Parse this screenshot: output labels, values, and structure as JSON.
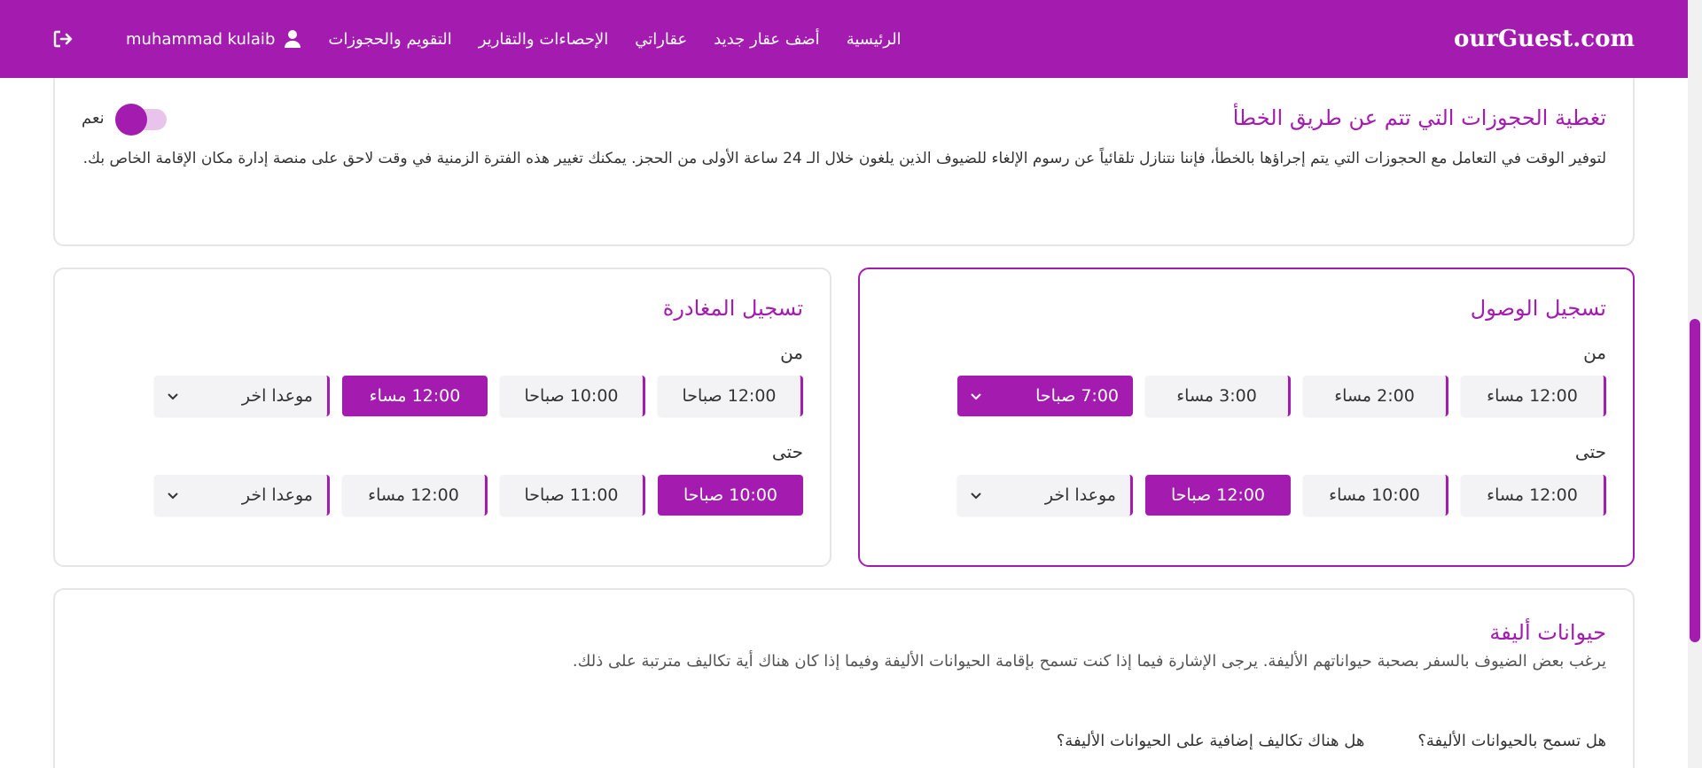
{
  "header": {
    "brand": "ourGuest.com",
    "nav": [
      "الرئيسية",
      "أضف عقار جديد",
      "عقاراتي",
      "الإحصاءات والتقارير",
      "التقويم والحجوزات"
    ],
    "user_name": "muhammad kulaib",
    "icons": {
      "user": "user-icon",
      "logout": "logout-icon"
    }
  },
  "mistaken_bookings": {
    "title": "تغطية الحجوزات التي تتم عن طريق الخطأ",
    "toggle_label": "نعم",
    "toggle_on": true,
    "description": "لتوفير الوقت في التعامل مع الحجوزات التي يتم إجراؤها بالخطأ، فإننا نتنازل تلقائياً عن رسوم الإلغاء للضيوف الذين يلغون خلال الـ 24 ساعة الأولى من الحجز. يمكنك تغيير هذه الفترة الزمنية في وقت لاحق على منصة إدارة مكان الإقامة الخاص بك."
  },
  "checkin": {
    "title": "تسجيل الوصول",
    "from_label": "من",
    "from_options": [
      "12:00 مساء",
      "2:00 مساء",
      "3:00 مساء"
    ],
    "from_selected": "7:00 صباحا",
    "to_label": "حتى",
    "to_options": [
      "12:00 مساء",
      "10:00 مساء"
    ],
    "to_selected": "12:00 صباحا",
    "to_other": "موعدا اخر"
  },
  "checkout": {
    "title": "تسجيل المغادرة",
    "from_label": "من",
    "from_options": [
      "12:00 صباحا",
      "10:00 صباحا"
    ],
    "from_selected": "12:00 مساء",
    "from_other": "موعدا اخر",
    "to_label": "حتى",
    "to_selected": "10:00 صباحا",
    "to_options": [
      "11:00 صباحا",
      "12:00 مساء"
    ],
    "to_other": "موعدا اخر"
  },
  "pets": {
    "title": "حيوانات أليفة",
    "description": "يرغب بعض الضيوف بالسفر بصحبة حيواناتهم الأليفة. يرجى الإشارة فيما إذا كنت تسمح بإقامة الحيوانات الأليفة وفيما إذا كان هناك أية تكاليف مترتبة على ذلك.",
    "question_allow": "هل تسمح بالحيوانات الأليفة؟",
    "question_fees": "هل هناك تكاليف إضافية على الحيوانات الأليفة؟"
  },
  "colors": {
    "accent": "#a31caf",
    "button_bg": "#f3f3f5",
    "border": "#e5e5e5"
  }
}
